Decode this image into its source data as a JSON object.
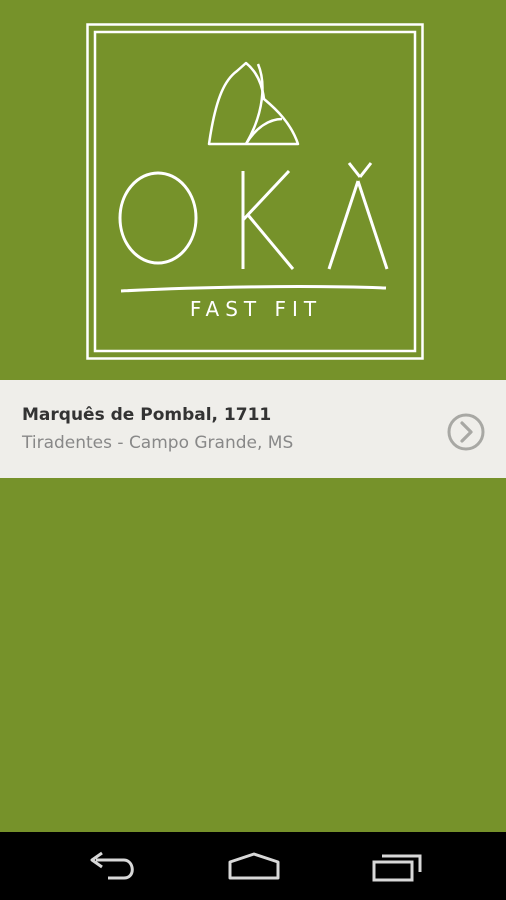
{
  "logo": {
    "name": "OKÀ",
    "tagline": "FAST FIT"
  },
  "location": {
    "street": "Marquês de Pombal, 1711",
    "district": "Tiradentes - Campo Grande, MS"
  },
  "icons": {
    "chevron": "chevron-right-circle-icon",
    "back": "back-icon",
    "home": "home-icon",
    "recents": "recent-apps-icon"
  },
  "colors": {
    "background": "#76922a",
    "card": "#efeeea",
    "street_text": "#333333",
    "district_text": "#888888",
    "navbar": "#000000"
  }
}
